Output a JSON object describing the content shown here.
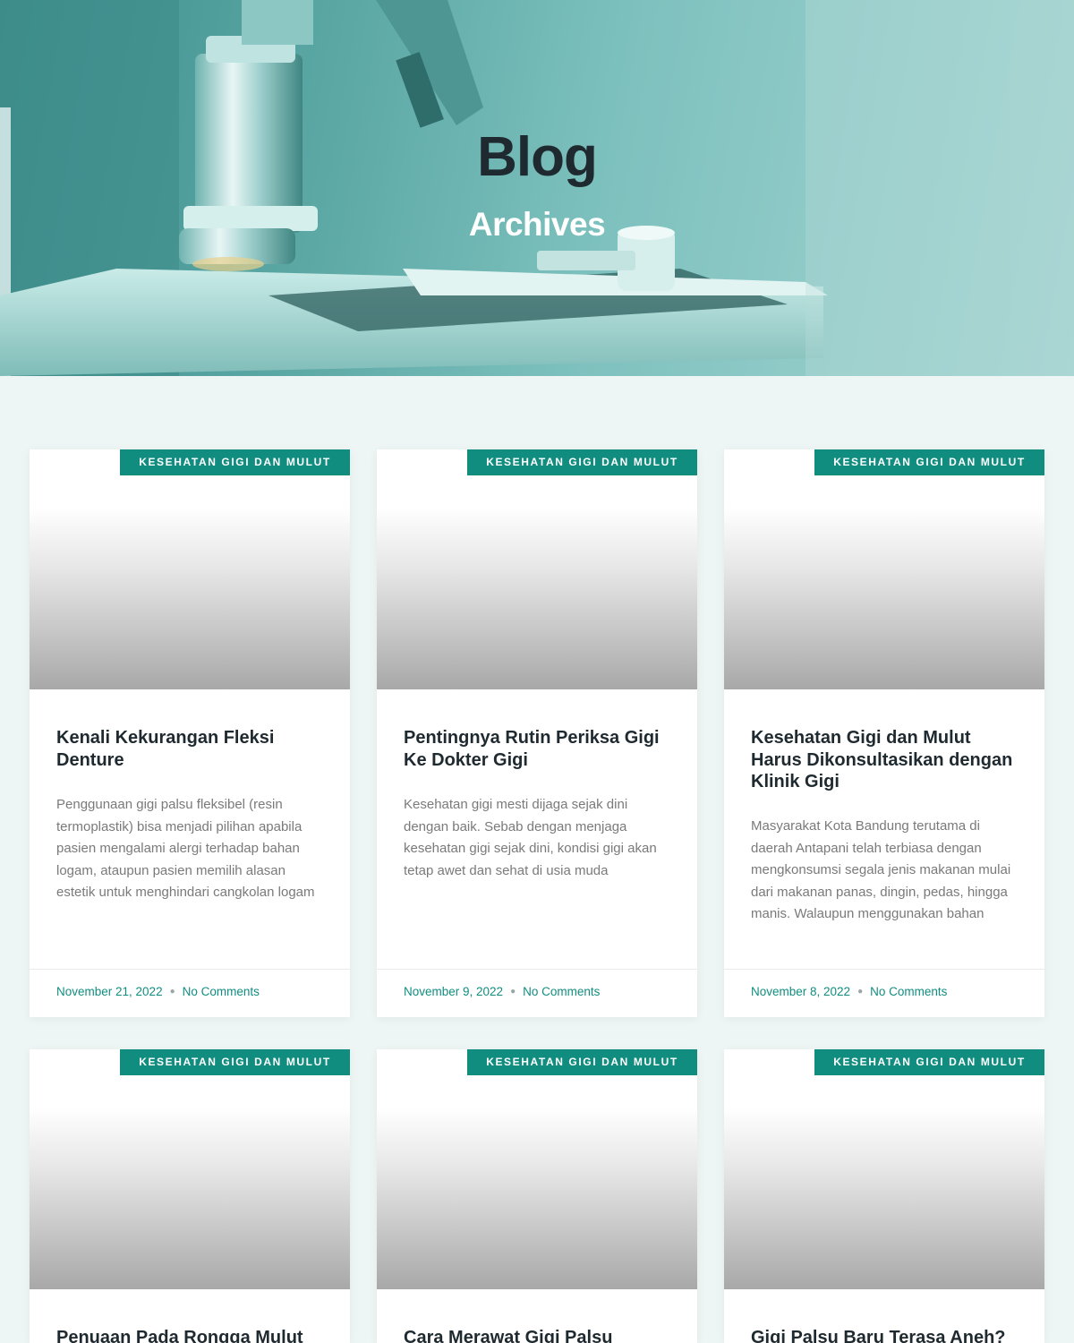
{
  "hero": {
    "title": "Blog",
    "subtitle": "Archives"
  },
  "colors": {
    "accent": "#118d80",
    "page_background": "#eef6f5",
    "heading": "#1f2a30"
  },
  "posts": [
    {
      "category": "KESEHATAN GIGI DAN MULUT",
      "title": "Kenali Kekurangan Fleksi Denture",
      "excerpt": "Penggunaan gigi palsu fleksibel (resin termoplastik) bisa menjadi pilihan apabila pasien mengalami alergi terhadap bahan logam, ataupun pasien memilih alasan estetik untuk menghindari cangkolan logam",
      "date": "November 21, 2022",
      "comments": "No Comments"
    },
    {
      "category": "KESEHATAN GIGI DAN MULUT",
      "title": "Pentingnya Rutin Periksa Gigi Ke Dokter Gigi",
      "excerpt": "Kesehatan gigi mesti dijaga sejak dini dengan baik. Sebab dengan menjaga kesehatan gigi sejak dini, kondisi gigi akan tetap awet dan sehat di usia muda",
      "date": "November 9, 2022",
      "comments": "No Comments"
    },
    {
      "category": "KESEHATAN GIGI DAN MULUT",
      "title": "Kesehatan Gigi dan Mulut Harus Dikonsultasikan dengan Klinik Gigi",
      "excerpt": "Masyarakat Kota Bandung terutama di daerah Antapani telah terbiasa dengan mengkonsumsi segala jenis makanan mulai dari makanan panas, dingin, pedas, hingga manis. Walaupun menggunakan bahan",
      "date": "November 8, 2022",
      "comments": "No Comments"
    },
    {
      "category": "KESEHATAN GIGI DAN MULUT",
      "title": "Penuaan Pada Rongga Mulut"
    },
    {
      "category": "KESEHATAN GIGI DAN MULUT",
      "title": "Cara Merawat Gigi Palsu"
    },
    {
      "category": "KESEHATAN GIGI DAN MULUT",
      "title": "Gigi Palsu Baru Terasa Aneh?"
    }
  ]
}
